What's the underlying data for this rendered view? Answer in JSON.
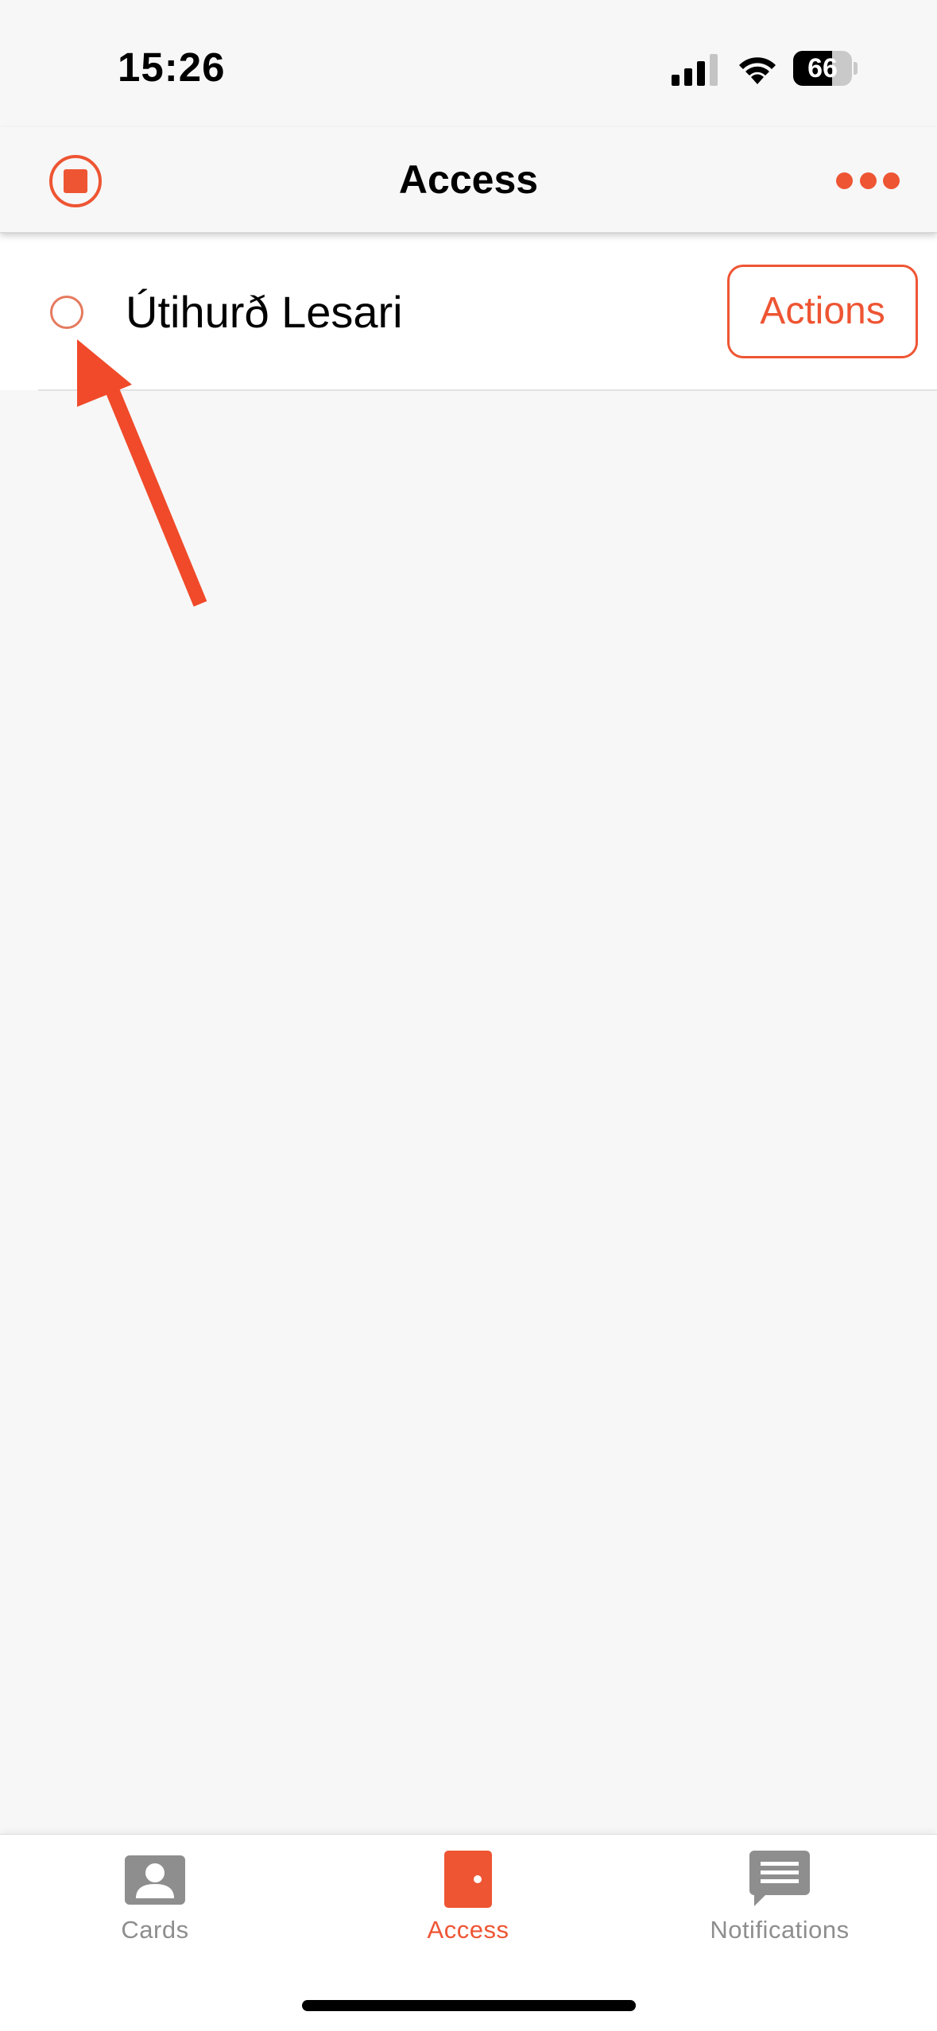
{
  "status_bar": {
    "time": "15:26",
    "battery_percent": "66",
    "battery_level": 0.66,
    "signal_icon": "cellular-signal-icon",
    "wifi_icon": "wifi-icon"
  },
  "nav": {
    "title": "Access",
    "left_icon": "stop-circle-icon",
    "right_icon": "more-dots-icon"
  },
  "list": {
    "items": [
      {
        "title": "Útihurð Lesari",
        "action_label": "Actions",
        "status_icon": "status-circle-icon"
      }
    ]
  },
  "tabs": [
    {
      "label": "Cards",
      "icon": "contact-card-icon",
      "active": false
    },
    {
      "label": "Access",
      "icon": "door-icon",
      "active": true
    },
    {
      "label": "Notifications",
      "icon": "message-icon",
      "active": false
    }
  ],
  "colors": {
    "accent": "#ee5533",
    "inactive_tab": "#8e8e8e",
    "background": "#f7f7f7",
    "annotation_arrow": "#f04a2a"
  }
}
